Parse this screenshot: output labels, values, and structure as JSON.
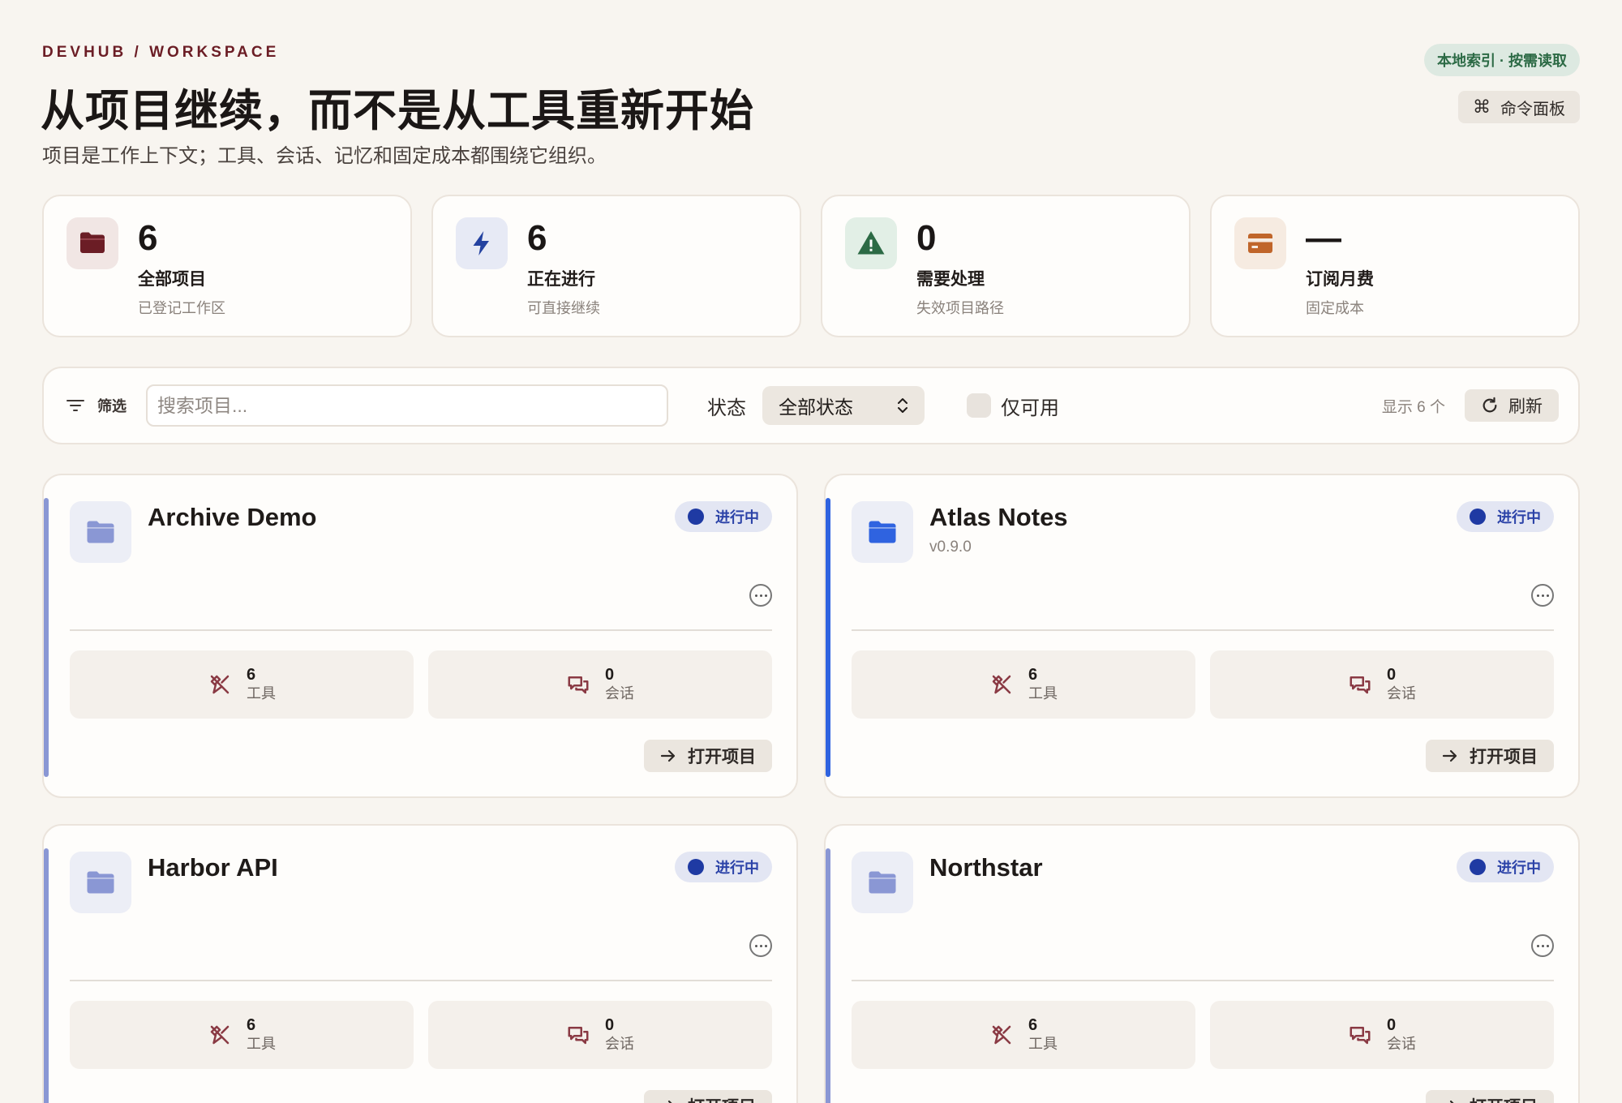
{
  "header": {
    "eyebrow": "DEVHUB / WORKSPACE",
    "title": "从项目继续，而不是从工具重新开始",
    "subtitle": "项目是工作上下文；工具、会话、记忆和固定成本都围绕它组织。",
    "index_pill": "本地索引 · 按需读取",
    "command_palette": "命令面板",
    "command_icon": "⌘"
  },
  "stats": [
    {
      "value": "6",
      "label": "全部项目",
      "sub": "已登记工作区",
      "icon": "folder-icon",
      "color": "#6b1d25"
    },
    {
      "value": "6",
      "label": "正在进行",
      "sub": "可直接继续",
      "icon": "lightning-icon",
      "color": "#2442a0"
    },
    {
      "value": "0",
      "label": "需要处理",
      "sub": "失效项目路径",
      "icon": "warning-icon",
      "color": "#2c6a45"
    },
    {
      "value": "—",
      "label": "订阅月费",
      "sub": "固定成本",
      "icon": "credit-card-icon",
      "color": "#c0652a"
    }
  ],
  "filter": {
    "label": "筛选",
    "search_placeholder": "搜索项目...",
    "status_label": "状态",
    "status_value": "全部状态",
    "available_only": "仅可用",
    "shown_count": "显示 6 个",
    "refresh": "刷新"
  },
  "projects": [
    {
      "name": "Archive Demo",
      "version": "",
      "status": "进行中",
      "tools": "6",
      "tools_label": "工具",
      "sessions": "0",
      "sessions_label": "会话",
      "open": "打开项目",
      "accent": "#8a97d4",
      "folder_color": "#8a97d4"
    },
    {
      "name": "Atlas Notes",
      "version": "v0.9.0",
      "status": "进行中",
      "tools": "6",
      "tools_label": "工具",
      "sessions": "0",
      "sessions_label": "会话",
      "open": "打开项目",
      "accent": "#2f63e0",
      "folder_color": "#2f63e0"
    },
    {
      "name": "Harbor API",
      "version": "",
      "status": "进行中",
      "tools": "6",
      "tools_label": "工具",
      "sessions": "0",
      "sessions_label": "会话",
      "open": "打开项目",
      "accent": "#8a97d4",
      "folder_color": "#8a97d4"
    },
    {
      "name": "Northstar",
      "version": "",
      "status": "进行中",
      "tools": "6",
      "tools_label": "工具",
      "sessions": "0",
      "sessions_label": "会话",
      "open": "打开项目",
      "accent": "#8a97d4",
      "folder_color": "#8a97d4"
    }
  ]
}
